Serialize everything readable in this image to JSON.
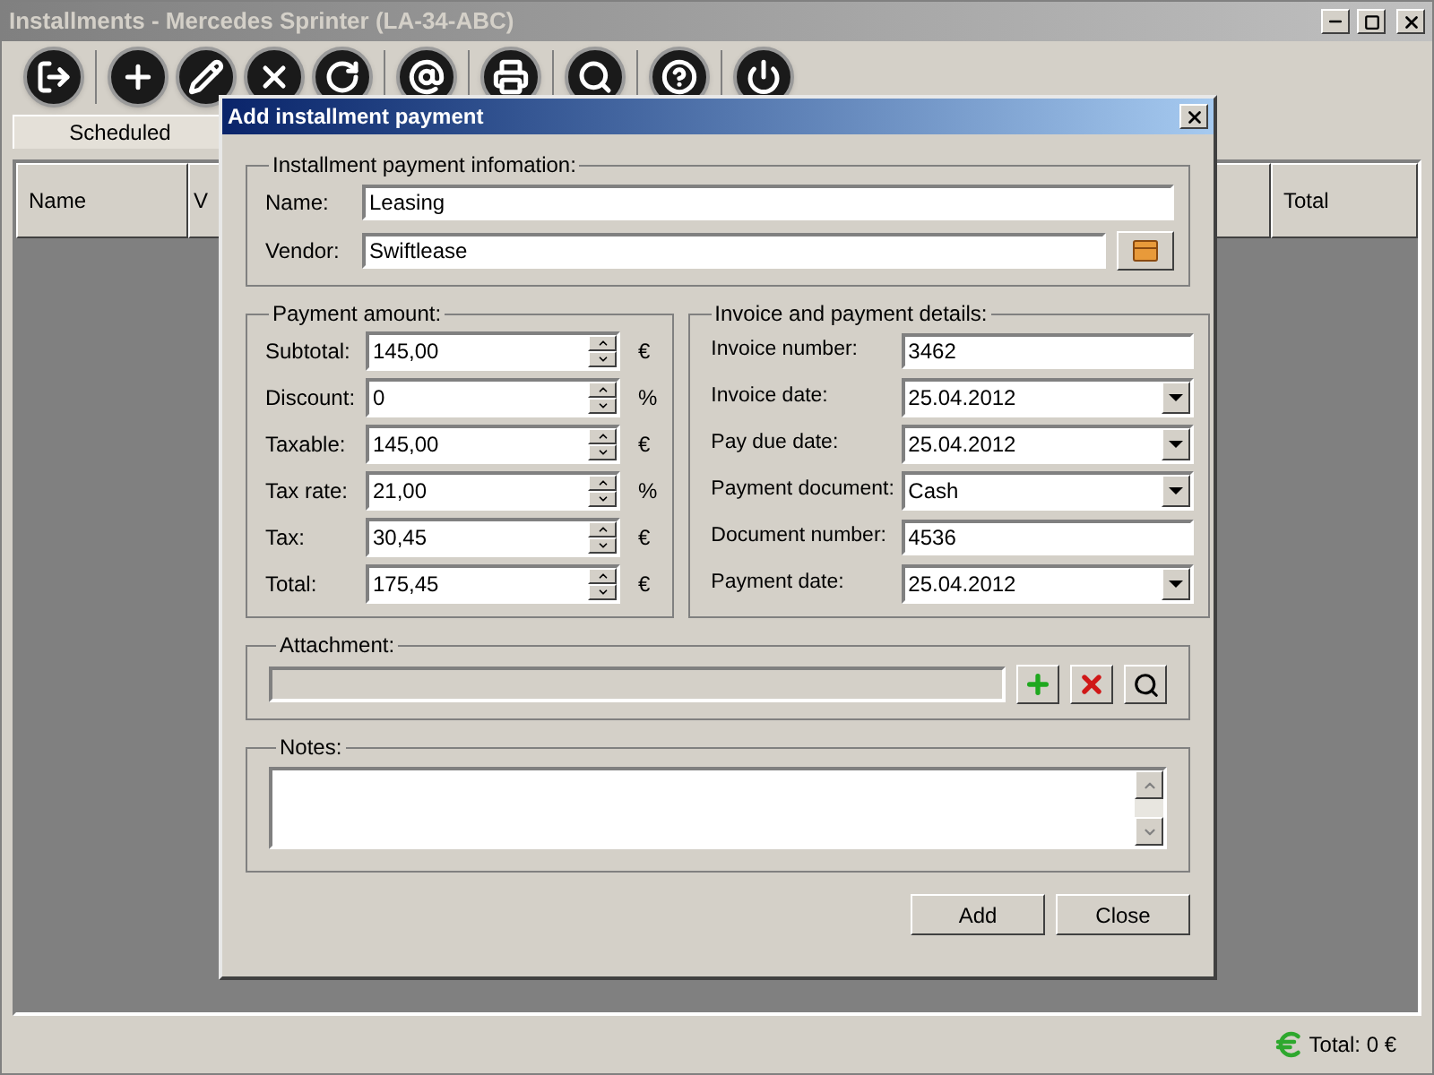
{
  "window": {
    "title": "Installments - Mercedes Sprinter (LA-34-ABC)"
  },
  "tabs": [
    {
      "label": "Scheduled",
      "selected": true
    }
  ],
  "table": {
    "columns": [
      "Name",
      "V",
      "Total"
    ]
  },
  "status_bar": {
    "total": "Total: 0 €"
  },
  "dialog": {
    "title": "Add installment payment",
    "info": {
      "legend": "Installment payment infomation:",
      "name_label": "Name:",
      "name_value": "Leasing",
      "vendor_label": "Vendor:",
      "vendor_value": "Swiftlease"
    },
    "amount": {
      "legend": "Payment amount:",
      "rows": [
        {
          "label": "Subtotal:",
          "value": "145,00",
          "unit": "€"
        },
        {
          "label": "Discount:",
          "value": "0",
          "unit": "%"
        },
        {
          "label": "Taxable:",
          "value": "145,00",
          "unit": "€"
        },
        {
          "label": "Tax rate:",
          "value": "21,00",
          "unit": "%"
        },
        {
          "label": "Tax:",
          "value": "30,45",
          "unit": "€"
        },
        {
          "label": "Total:",
          "value": "175,45",
          "unit": "€"
        }
      ]
    },
    "details": {
      "legend": "Invoice and payment details:",
      "rows": [
        {
          "label": "Invoice number:",
          "value": "3462",
          "kind": "text"
        },
        {
          "label": "Invoice date:",
          "value": "25.04.2012",
          "kind": "dropdown"
        },
        {
          "label": "Pay due date:",
          "value": "25.04.2012",
          "kind": "dropdown"
        },
        {
          "label": "Payment document:",
          "value": "Cash",
          "kind": "dropdown"
        },
        {
          "label": "Document number:",
          "value": "4536",
          "kind": "text"
        },
        {
          "label": "Payment date:",
          "value": "25.04.2012",
          "kind": "dropdown"
        }
      ]
    },
    "attachment": {
      "legend": "Attachment:"
    },
    "notes": {
      "legend": "Notes:"
    },
    "buttons": [
      "Add",
      "Close"
    ]
  }
}
